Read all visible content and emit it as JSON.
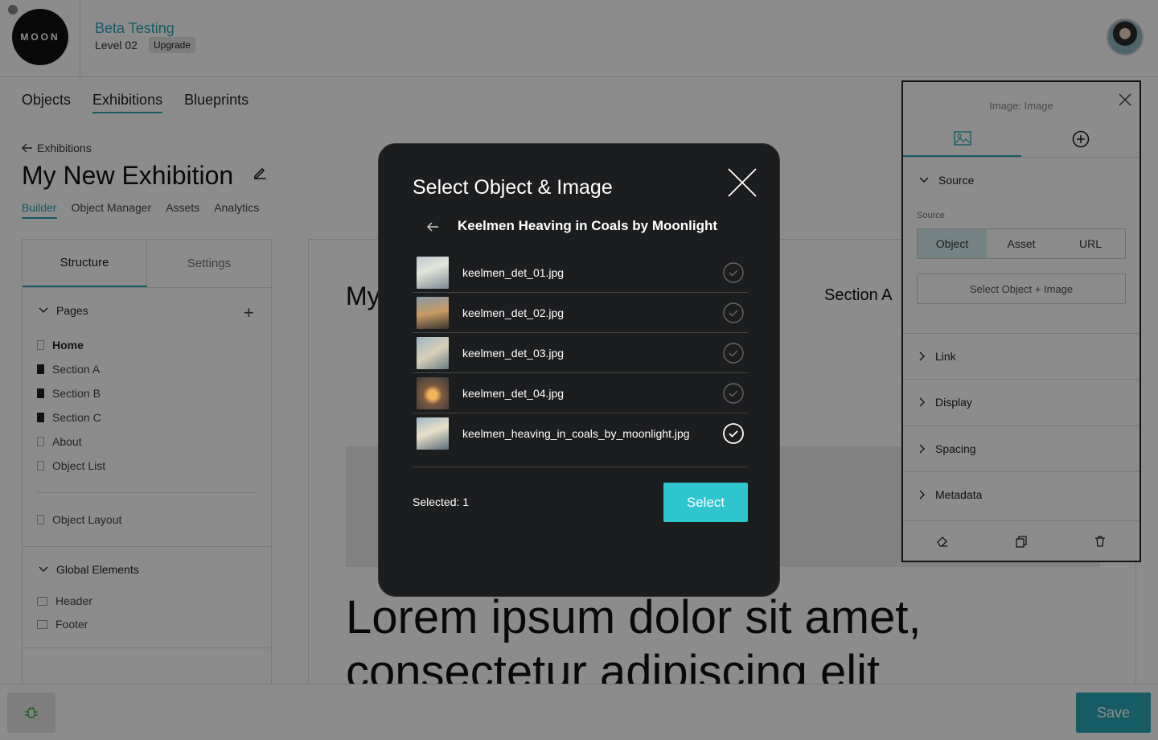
{
  "topbar": {
    "logo_text": "MOON",
    "org_name": "Beta Testing",
    "level": "Level 02",
    "upgrade_label": "Upgrade"
  },
  "main_nav": {
    "tabs": [
      "Objects",
      "Exhibitions",
      "Blueprints"
    ],
    "active": "Exhibitions"
  },
  "breadcrumb": {
    "back_label": "Exhibitions"
  },
  "page": {
    "title": "My New Exhibition"
  },
  "sub_nav": {
    "tabs": [
      "Builder",
      "Object Manager",
      "Assets",
      "Analytics"
    ],
    "active": "Builder"
  },
  "left_panel": {
    "tabs": [
      "Structure",
      "Settings"
    ],
    "pages_label": "Pages",
    "pages": [
      {
        "label": "Home",
        "icon": "doc-outline-icon",
        "bold": true
      },
      {
        "label": "Section A",
        "icon": "doc-filled-icon"
      },
      {
        "label": "Section B",
        "icon": "doc-filled-icon"
      },
      {
        "label": "Section C",
        "icon": "doc-filled-icon"
      },
      {
        "label": "About",
        "icon": "doc-outline-icon"
      },
      {
        "label": "Object List",
        "icon": "doc-outline-icon"
      }
    ],
    "object_layout": "Object Layout",
    "global_label": "Global Elements",
    "global_items": [
      "Header",
      "Footer"
    ]
  },
  "canvas": {
    "heading": "My",
    "nav_item": "Section A",
    "lorem_line1": "Lorem ipsum dolor sit amet,",
    "lorem_line2": "consectetur adipiscing elit"
  },
  "right_panel": {
    "title": "Image: Image",
    "source_section": "Source",
    "source_label": "Source",
    "source_options": [
      "Object",
      "Asset",
      "URL"
    ],
    "source_active": "Object",
    "select_button": "Select Object + Image",
    "sections": [
      "Link",
      "Display",
      "Spacing",
      "Metadata"
    ]
  },
  "bottombar": {
    "save_label": "Save"
  },
  "modal": {
    "title": "Select Object & Image",
    "object_name": "Keelmen Heaving in Coals by Moonlight",
    "files": [
      {
        "name": "keelmen_det_01.jpg",
        "selected": false
      },
      {
        "name": "keelmen_det_02.jpg",
        "selected": false
      },
      {
        "name": "keelmen_det_03.jpg",
        "selected": false
      },
      {
        "name": "keelmen_det_04.jpg",
        "selected": false
      },
      {
        "name": "keelmen_heaving_in_coals_by_moonlight.jpg",
        "selected": true
      }
    ],
    "selected_text": "Selected: 1",
    "select_label": "Select"
  },
  "colors": {
    "accent": "#2aa6b6",
    "modal_bg": "#1c1d1f",
    "select_button": "#2ec5cf"
  }
}
